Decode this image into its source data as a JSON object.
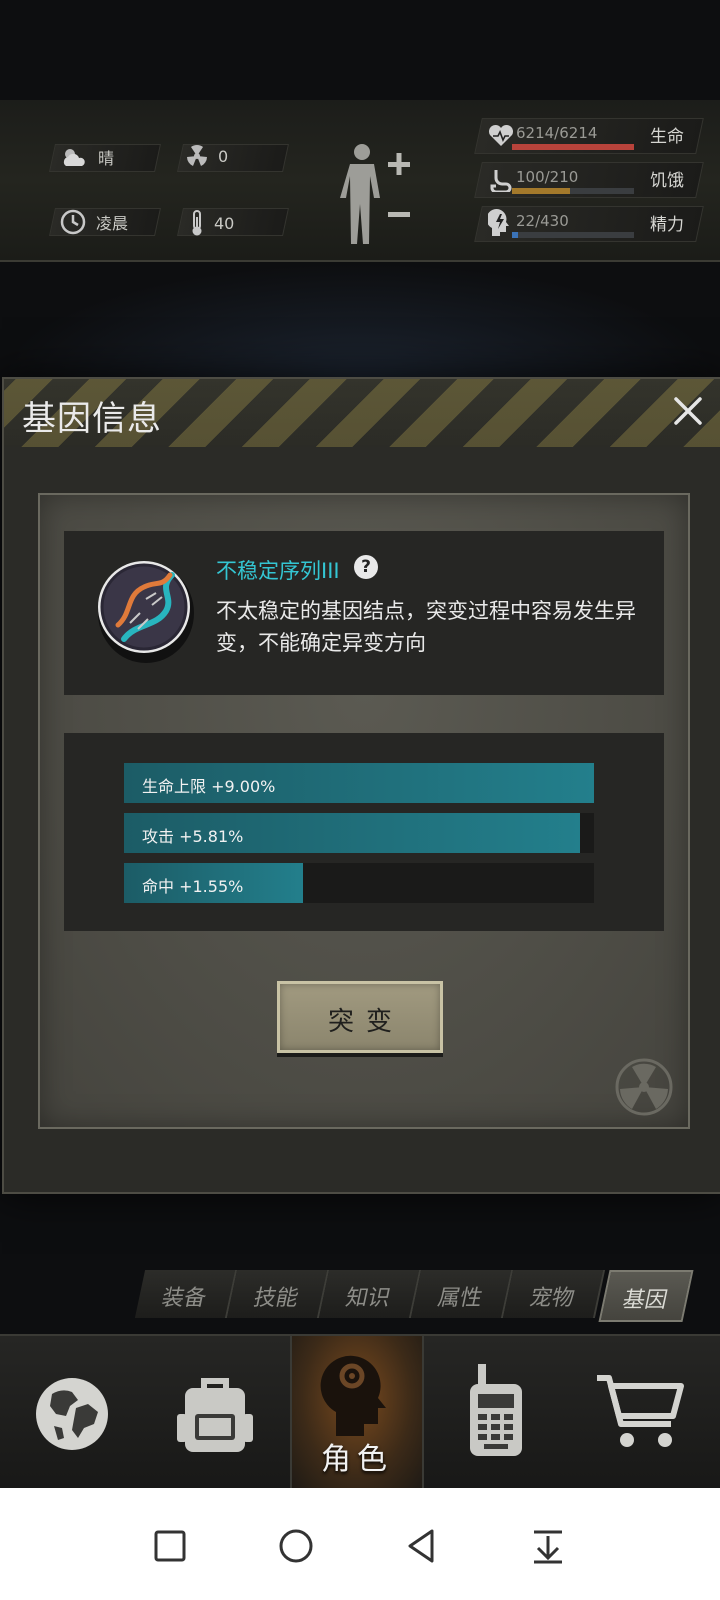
{
  "status": {
    "weather": "晴",
    "radiation": "0",
    "time_of_day": "凌晨",
    "temperature": "40",
    "health": {
      "label": "生命",
      "value": "6214/6214",
      "fraction": 1.0,
      "color": "#b8433b"
    },
    "hunger": {
      "label": "饥饿",
      "value": "100/210",
      "fraction": 0.476,
      "color": "#a3792b"
    },
    "energy": {
      "label": "精力",
      "value": "22/430",
      "fraction": 0.051,
      "color": "#3b73b8"
    }
  },
  "dialog": {
    "title": "基因信息",
    "gene": {
      "name": "不稳定序列III",
      "help": "?",
      "description": "不太稳定的基因结点，突变过程中容易发生异变，不能确定异变方向"
    },
    "attributes": [
      {
        "label": "生命上限 +9.00%",
        "fraction": 1.0
      },
      {
        "label": "攻击 +5.81%",
        "fraction": 0.97
      },
      {
        "label": "命中 +1.55%",
        "fraction": 0.38
      }
    ],
    "mutate_label": "突变"
  },
  "tabs": [
    {
      "label": "装备"
    },
    {
      "label": "技能"
    },
    {
      "label": "知识"
    },
    {
      "label": "属性"
    },
    {
      "label": "宠物"
    },
    {
      "label": "基因",
      "active": true
    }
  ],
  "bottom_nav": {
    "role_label": "角色"
  },
  "colors": {
    "accent_cyan": "#34c6d3",
    "attr_bar": "#237f8c",
    "button": "#968f77"
  }
}
